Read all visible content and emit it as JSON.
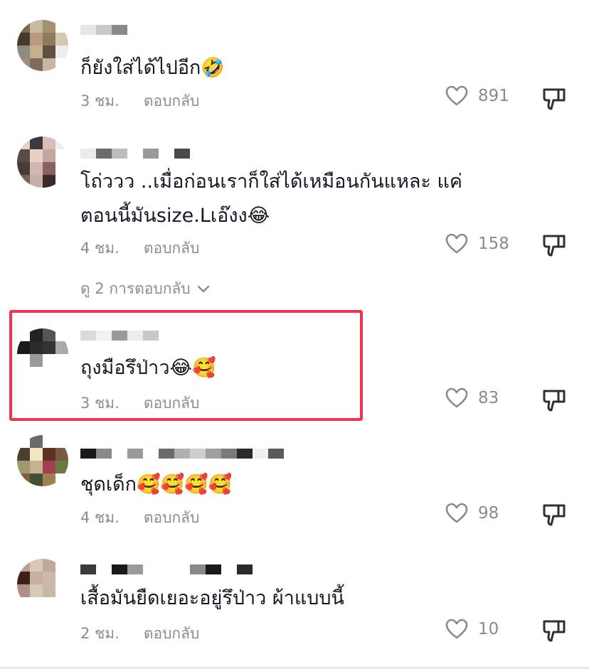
{
  "comments": [
    {
      "text": "ก็ยังใส่ได้ไปอีก🤣",
      "time": "3 ชม.",
      "reply_label": "ตอบกลับ",
      "likes": "891",
      "avatar_colors": [
        "#7a6a55",
        "#c9b9a0",
        "#a3916f",
        "#ffffff",
        "#4a3a2a",
        "#b89a80",
        "#8f7a60",
        "#d8c8b0",
        "#8d8d7d",
        "#c4b090",
        "#5d5040",
        "#eeeeee",
        "#a09080",
        "#7d6d5d",
        "#c8b8a0",
        "#ffffff"
      ]
    },
    {
      "text_line1": "โถ่ววว ..เมื่อก่อนเราก็ใส่ได้เหมือนกันแหละ แค่",
      "text_line2": "ตอนนี้มันsize.Lเอ๊งง😂",
      "time": "4 ชม.",
      "reply_label": "ตอบกลับ",
      "likes": "158",
      "view_replies": "ดู 2 การตอบกลับ",
      "avatar_colors": [
        "#e0d0c8",
        "#3a3a3a",
        "#d8c0b8",
        "#eeeeee",
        "#5a4a48",
        "#e8d0c8",
        "#c0a8a0",
        "#ffffff",
        "#4a3a38",
        "#d0b8b0",
        "#886060",
        "#ffffff",
        "#7a6060",
        "#c8b0a8",
        "#3a2a28",
        "#ffffff"
      ]
    },
    {
      "text": "ถุงมือรึป่าว😂🥰",
      "time": "3 ชม.",
      "reply_label": "ตอบกลับ",
      "likes": "83",
      "avatar_colors": [
        "#ffffff",
        "#222222",
        "#555555",
        "#ffffff",
        "#1a1a1a",
        "#2a2a2a",
        "#333333",
        "#aaaaaa",
        "#ffffff",
        "#9a9a9a",
        "#ffffff",
        "#ffffff",
        "#ffffff",
        "#ffffff",
        "#ffffff",
        "#ffffff"
      ]
    },
    {
      "text": "ชุดเด็ก🥰🥰🥰🥰",
      "time": "4 ชม.",
      "reply_label": "ตอบกลับ",
      "likes": "98",
      "avatar_colors": [
        "#ffffff",
        "#6a6a6a",
        "#ffffff",
        "#ffffff",
        "#4a4030",
        "#f0e8c0",
        "#603020",
        "#7a5a40",
        "#a09870",
        "#c8b090",
        "#a04050",
        "#6a7a40",
        "#806040",
        "#405030",
        "#a08050",
        "#ffffff"
      ]
    },
    {
      "text": "เสื้อมันยืดเยอะอยู่รึป่าว ผ้าแบบนี้",
      "time": "2 ชม.",
      "reply_label": "ตอบกลับ",
      "likes": "10",
      "avatar_colors": [
        "#b8a090",
        "#d8c8b8",
        "#c0a898",
        "#ffffff",
        "#3a2018",
        "#c8b0a0",
        "#d0b8a8",
        "#ffffff",
        "#b09080",
        "#d8c8b8",
        "#c8b8a8",
        "#ffffff",
        "#ffffff",
        "#ffffff",
        "#ffffff",
        "#ffffff"
      ]
    }
  ],
  "colors": {
    "highlight": "#f1334f",
    "meta": "#8a8b91",
    "text": "#161823"
  }
}
